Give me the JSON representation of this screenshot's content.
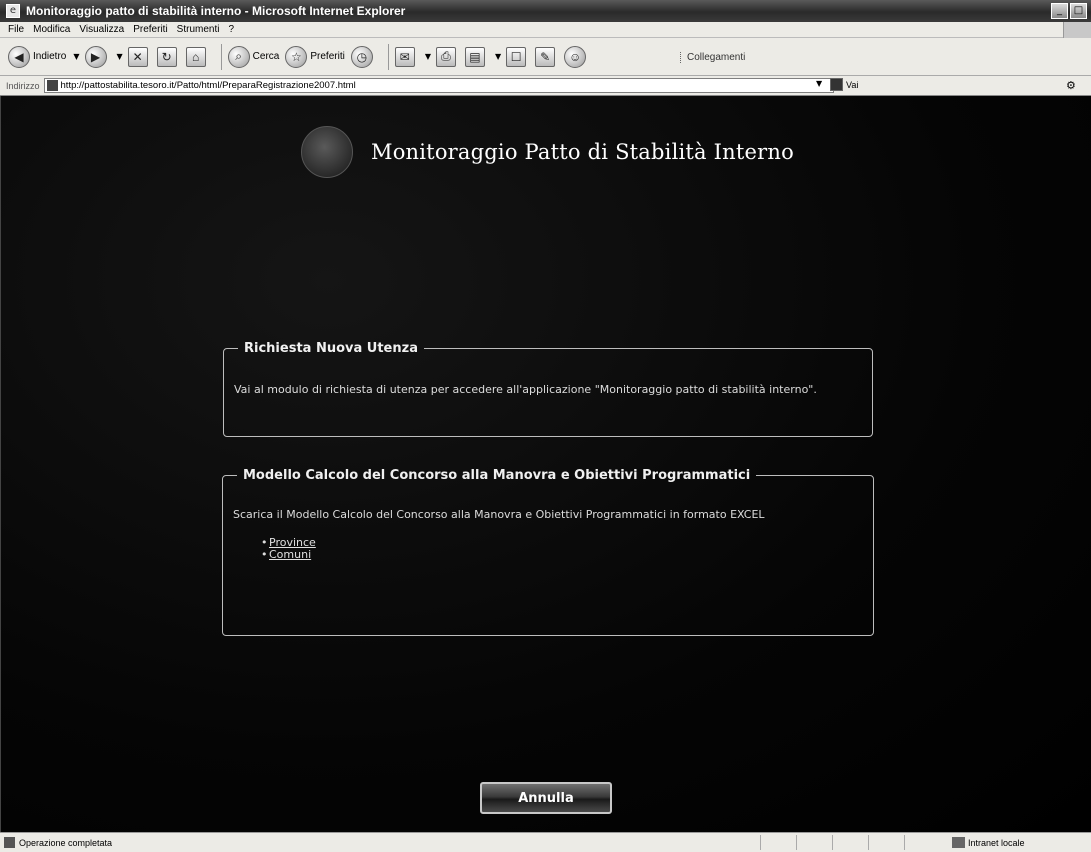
{
  "window": {
    "title": "Monitoraggio patto di stabilità interno - Microsoft Internet Explorer"
  },
  "menu": [
    "File",
    "Modifica",
    "Visualizza",
    "Preferiti",
    "Strumenti",
    "?"
  ],
  "toolbar": {
    "back_label": "Indietro",
    "search_label": "Cerca",
    "favorites_label": "Preferiti",
    "links_label": "Collegamenti"
  },
  "address": {
    "label": "Indirizzo",
    "url": "http://pattostabilita.tesoro.it/Patto/html/PreparaRegistrazione2007.html",
    "go_label": "Vai"
  },
  "page": {
    "title": "Monitoraggio Patto di Stabilità Interno",
    "box1": {
      "legend": "Richiesta Nuova Utenza",
      "text": "Vai al modulo di richiesta di utenza per accedere all'applicazione \"Monitoraggio patto di stabilità interno\"."
    },
    "box2": {
      "legend": "Modello Calcolo del Concorso alla Manovra e Obiettivi Programmatici",
      "text": "Scarica il Modello Calcolo del Concorso alla Manovra e Obiettivi Programmatici in formato EXCEL",
      "links": [
        "Province",
        "Comuni"
      ]
    },
    "cancel_label": "Annulla"
  },
  "status": {
    "text": "Operazione completata",
    "zone": "Intranet locale"
  }
}
